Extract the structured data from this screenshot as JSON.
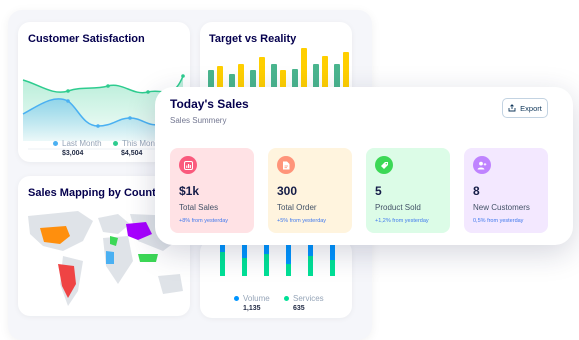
{
  "customer_satisfaction": {
    "title": "Customer Satisfaction",
    "legend": [
      {
        "label": "Last Month",
        "value": "$3,004",
        "color": "#4ab0f2"
      },
      {
        "label": "This Month",
        "value": "$4,504",
        "color": "#2ecc8f"
      }
    ]
  },
  "target_vs_reality": {
    "title": "Target vs Reality",
    "colors": {
      "reality": "#4ab58e",
      "target": "#ffcf00"
    }
  },
  "sales_mapping": {
    "title": "Sales Mapping by Country"
  },
  "volume_services": {
    "legend": [
      {
        "label": "Volume",
        "value": "1,135",
        "color": "#0095ff"
      },
      {
        "label": "Services",
        "value": "635",
        "color": "#00e096"
      }
    ]
  },
  "todays_sales": {
    "title": "Today's Sales",
    "subtitle": "Sales Summery",
    "export_label": "Export",
    "stats": [
      {
        "value": "$1k",
        "label": "Total Sales",
        "change": "+8% from yesterday",
        "bg": "#ffe2e5",
        "icon_bg": "#fa5a7d",
        "icon": "bar-chart-icon"
      },
      {
        "value": "300",
        "label": "Total Order",
        "change": "+5% from yesterday",
        "bg": "#fff4de",
        "icon_bg": "#ff947a",
        "icon": "document-icon"
      },
      {
        "value": "5",
        "label": "Product Sold",
        "change": "+1,2% from yesterday",
        "bg": "#dcfce7",
        "icon_bg": "#3cd856",
        "icon": "tag-icon"
      },
      {
        "value": "8",
        "label": "New Customers",
        "change": "0,5% from yesterday",
        "bg": "#f3e8ff",
        "icon_bg": "#bf83ff",
        "icon": "add-user-icon"
      }
    ]
  }
}
